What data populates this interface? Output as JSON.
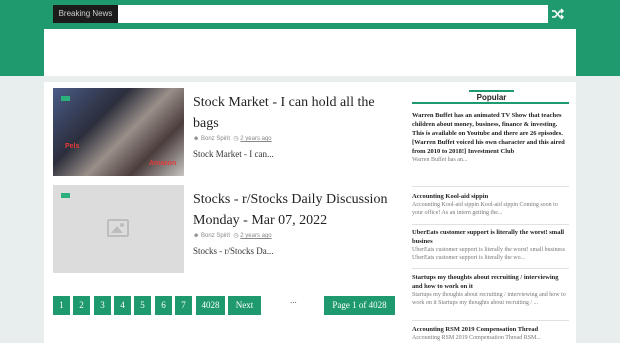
{
  "topbar": {
    "breaking_label": "Breaking News",
    "shuffle_icon": "shuffle-icon"
  },
  "colors": {
    "brand_green": "#1f9a6e",
    "page_bg": "#e8eeed",
    "dark": "#1b1b1b"
  },
  "posts": [
    {
      "title": "Stock Market - I can hold all the bags",
      "author": "Bonz Spirit",
      "time": "2 years ago",
      "excerpt": "Stock Market - I can...",
      "thumb_text_1": "Pelѕ",
      "thumb_text_2": "Amazon"
    },
    {
      "title": "Stocks - r/Stocks Daily Discussion Monday - Mar 07, 2022",
      "author": "Bonz Spirit",
      "time": "2 years ago",
      "excerpt": "Stocks - r/Stocks Da..."
    }
  ],
  "pagination": {
    "pages": [
      "1",
      "2",
      "3",
      "4",
      "5",
      "6",
      "7",
      "4028"
    ],
    "next": "Next",
    "ellipsis": "...",
    "page_of": "Page 1 of 4028"
  },
  "sidebar": {
    "heading": "Popular",
    "items": [
      {
        "title": "Warren Buffet has an animated TV Show that teaches children about money, business, finance & investing. This is available on Youtube and there are 26 episodes. [Warren Buffet voiced his own character and this aired from 2010 to 2018!] Investment Club",
        "excerpt": "Warren Buffet has an..."
      },
      {
        "title": "Accounting Kool-aid sippin",
        "excerpt": "Accounting Kool-aid sippin Kool-aid sippin Coming soon to your office! As an intern getting the..."
      },
      {
        "title": "UberEats customer support is literally the worst! small busines",
        "excerpt": "UberEats customer support is literally the worst! small business UberEats customer support is literally the wo..."
      },
      {
        "title": "Startups my thoughts about recruiting / interviewing and how to work on it",
        "excerpt": "Startups my thoughts about recruiting / interviewing and how to work on it Startups my thoughts about recruiting / ..."
      },
      {
        "title": "Accounting RSM 2019 Compensation Thread",
        "excerpt": "Accounting RSM 2019 Compensation Thread RSM..."
      }
    ]
  }
}
